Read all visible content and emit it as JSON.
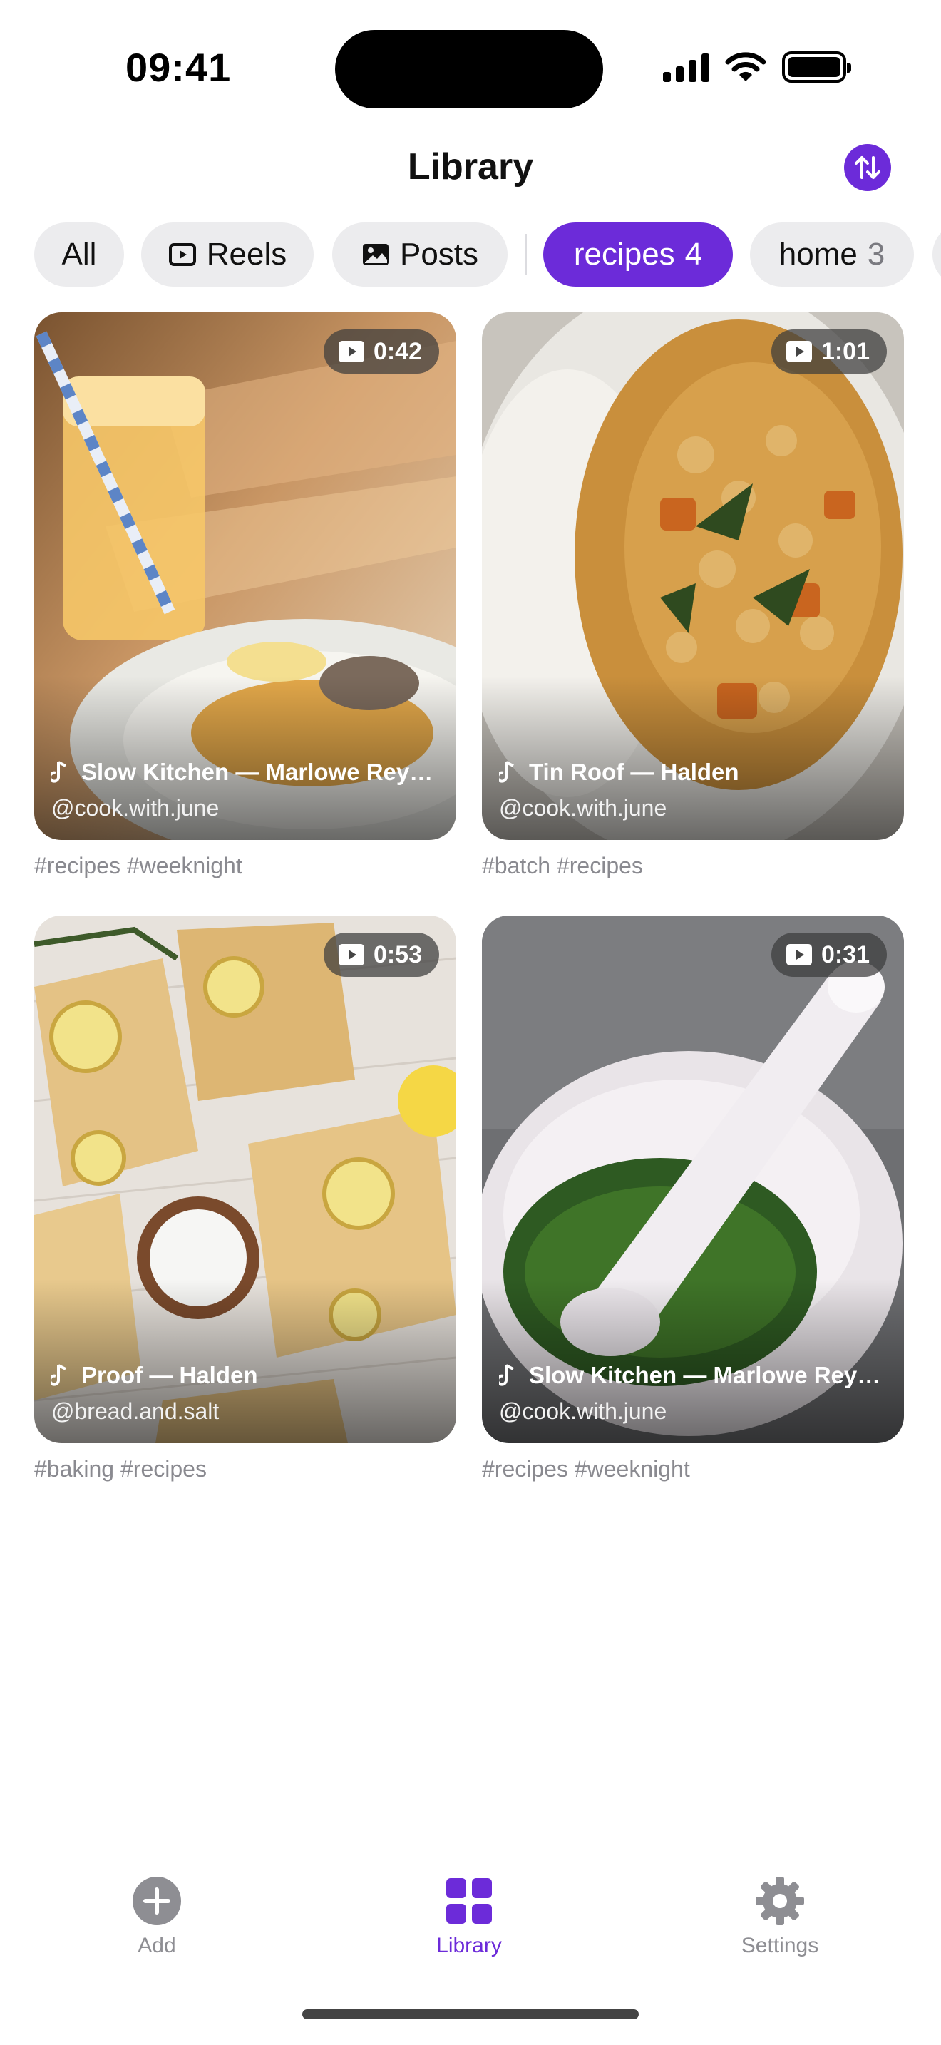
{
  "status_bar": {
    "time": "09:41"
  },
  "header": {
    "title": "Library"
  },
  "filters": [
    {
      "label": "All",
      "count": "",
      "icon": ""
    },
    {
      "label": "Reels",
      "count": "",
      "icon": "play-square-icon"
    },
    {
      "label": "Posts",
      "count": "",
      "icon": "image-icon"
    },
    {
      "label": "recipes",
      "count": "4",
      "icon": "",
      "active": true
    },
    {
      "label": "home",
      "count": "3",
      "icon": ""
    }
  ],
  "cards": [
    {
      "duration": "0:42",
      "audio": "Slow Kitchen — Marlowe Rey…",
      "handle": "@cook.with.june",
      "tags": "#recipes #weeknight"
    },
    {
      "duration": "1:01",
      "audio": "Tin Roof — Halden",
      "handle": "@cook.with.june",
      "tags": "#batch #recipes"
    },
    {
      "duration": "0:53",
      "audio": "Proof — Halden",
      "handle": "@bread.and.salt",
      "tags": "#baking #recipes"
    },
    {
      "duration": "0:31",
      "audio": "Slow Kitchen — Marlowe Rey…",
      "handle": "@cook.with.june",
      "tags": "#recipes #weeknight"
    }
  ],
  "tabbar": {
    "add": "Add",
    "library": "Library",
    "settings": "Settings"
  },
  "colors": {
    "accent": "#6c2bd9",
    "chip_bg": "#ececee",
    "muted": "#8e8e93"
  }
}
